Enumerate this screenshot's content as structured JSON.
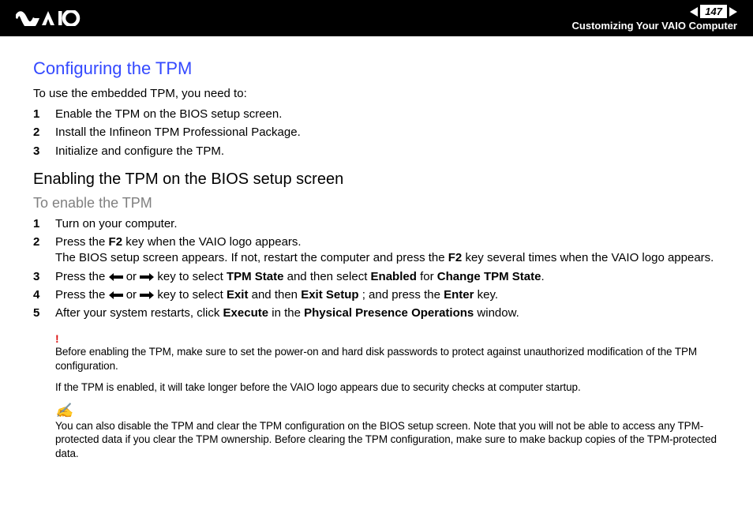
{
  "header": {
    "page_number": "147",
    "section": "Customizing Your VAIO Computer"
  },
  "title": "Configuring the TPM",
  "intro": "To use the embedded TPM, you need to:",
  "steps1": [
    "Enable the TPM on the BIOS setup screen.",
    "Install the Infineon TPM Professional Package.",
    "Initialize and configure the TPM."
  ],
  "h2": "Enabling the TPM on the BIOS setup screen",
  "h3": "To enable the TPM",
  "s2": {
    "1": "Turn on your computer.",
    "2a": "Press the ",
    "2b": " key when the VAIO logo appears.",
    "2c": "The BIOS setup screen appears. If not, restart the computer and press the ",
    "2d": " key several times when the VAIO logo appears.",
    "3a": "Press the ",
    "3b": " or ",
    "3c": " key to select ",
    "3d": " and then select ",
    "3e": " for ",
    "3f": ".",
    "4a": "Press the ",
    "4b": " or ",
    "4c": " key to select ",
    "4d": " and then ",
    "4e": "; and press the ",
    "4f": " key.",
    "5a": "After your system restarts, click ",
    "5b": " in the ",
    "5c": " window."
  },
  "bold": {
    "F2": "F2",
    "TPMState": "TPM State",
    "Enabled": "Enabled",
    "ChangeTPMState": "Change TPM State",
    "Exit": "Exit",
    "ExitSetup": "Exit Setup",
    "Enter": "Enter",
    "Execute": "Execute",
    "PPO": "Physical Presence Operations"
  },
  "warn_mark": "!",
  "warn1": "Before enabling the TPM, make sure to set the power-on and hard disk passwords to protect against unauthorized modification of the TPM configuration.",
  "warn2": "If the TPM is enabled, it will take longer before the VAIO logo appears due to security checks at computer startup.",
  "pencil": "✍",
  "tip": "You can also disable the TPM and clear the TPM configuration on the BIOS setup screen. Note that you will not be able to access any TPM-protected data if you clear the TPM ownership. Before clearing the TPM configuration, make sure to make backup copies of the TPM-protected data."
}
